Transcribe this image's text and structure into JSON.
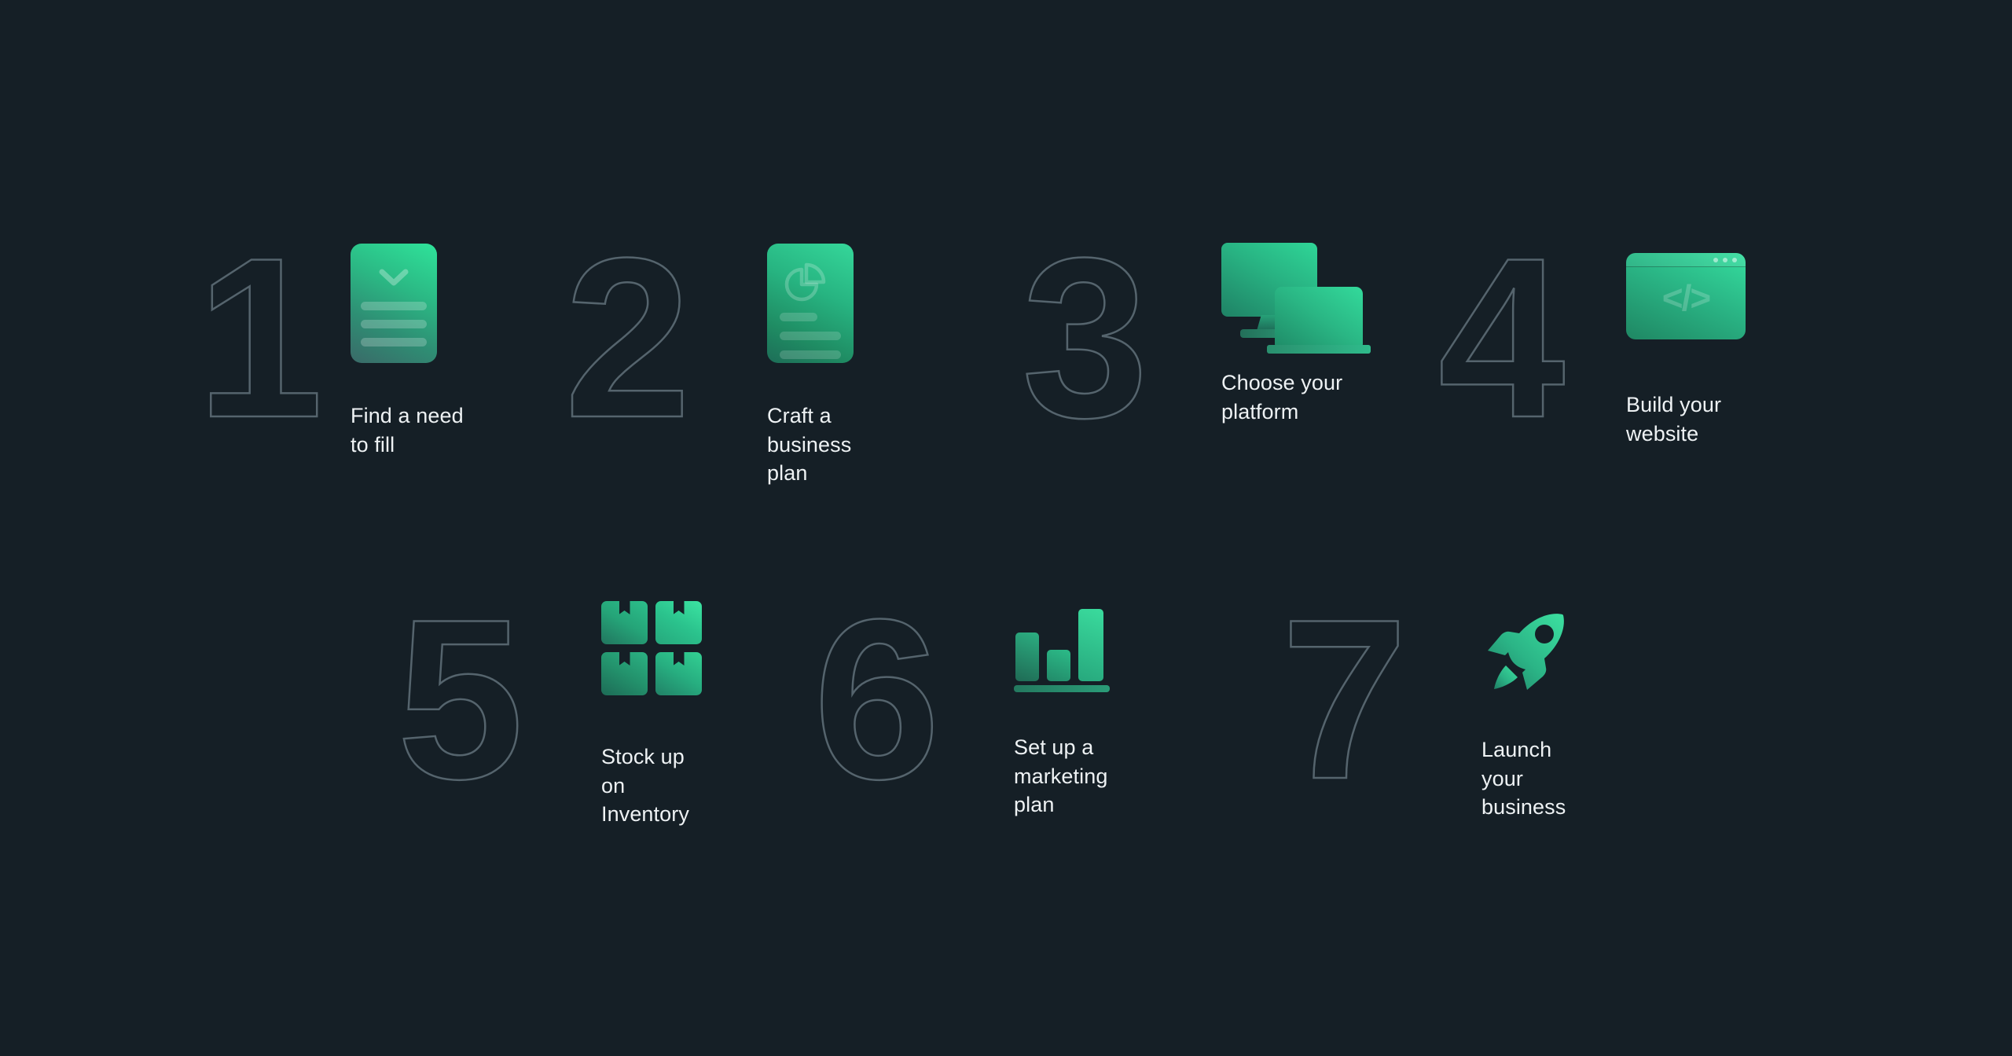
{
  "page": {
    "background_color": "#151f26",
    "numeral_stroke_color": "#55646d",
    "label_color": "#eef2f4",
    "accent_gradient_from": "#35dd9e",
    "accent_gradient_to": "#1f6b55"
  },
  "steps": [
    {
      "number": "1",
      "label": "Find a need\nto fill",
      "icon": "document-checklist-icon",
      "code_glyph": ""
    },
    {
      "number": "2",
      "label": "Craft a business\nplan",
      "icon": "document-pie-chart-icon",
      "code_glyph": ""
    },
    {
      "number": "3",
      "label": "Choose your\nplatform",
      "icon": "monitor-laptop-icon",
      "code_glyph": ""
    },
    {
      "number": "4",
      "label": "Build your website",
      "icon": "browser-code-icon",
      "code_glyph": "</>"
    },
    {
      "number": "5",
      "label": "Stock up on\nInventory",
      "icon": "boxes-inventory-icon",
      "code_glyph": ""
    },
    {
      "number": "6",
      "label": "Set up a marketing\nplan",
      "icon": "bar-chart-icon",
      "code_glyph": ""
    },
    {
      "number": "7",
      "label": "Launch your\nbusiness",
      "icon": "rocket-icon",
      "code_glyph": ""
    }
  ]
}
